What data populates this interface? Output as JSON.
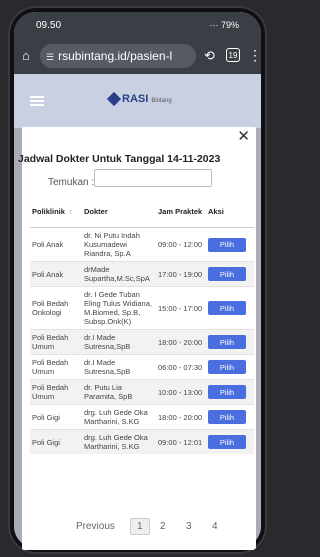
{
  "status": {
    "time": "09.50",
    "signal": "··· 79%"
  },
  "browser": {
    "url": "rsubintang.id/pasien-l",
    "tabs_count": "19"
  },
  "site": {
    "logo_text": "RASI",
    "logo_sub": "Bintang"
  },
  "modal": {
    "title": "Jadwal Dokter Untuk Tanggal 14-11-2023",
    "search_label": "Temukan :",
    "search_value": "",
    "columns": [
      "Poliklinik",
      "Dokter",
      "Jam Praktek",
      "Aksi"
    ],
    "action_label": "Pilih",
    "rows": [
      {
        "poli": "Poli Anak",
        "dokter": "dr. Ni Putu Indah Kusumadewi Riandra, Sp.A",
        "jam": "09:00 - 12:00"
      },
      {
        "poli": "Poli Anak",
        "dokter": "drMade Supartha,M.Sc,SpA",
        "jam": "17:00 - 19:00"
      },
      {
        "poli": "Poli Bedah Onkologi",
        "dokter": "dr. I Gede Tuban Eling Tulus Widiana, M.Biomed, Sp.B, Subsp.Onk(K)",
        "jam": "15:00 - 17:00"
      },
      {
        "poli": "Poli Bedah Umum",
        "dokter": "dr.I Made Sutresna,SpB",
        "jam": "18:00 - 20:00"
      },
      {
        "poli": "Poli Bedah Umum",
        "dokter": "dr.I Made Sutresna,SpB",
        "jam": "06:00 - 07:30"
      },
      {
        "poli": "Poli Bedah Umum",
        "dokter": "dr. Putu Lia Paramita, SpB",
        "jam": "10:00 - 13:00"
      },
      {
        "poli": "Poli Gigi",
        "dokter": "drg. Luh Gede Oka Martharini, S.KG",
        "jam": "18:00 - 20:00"
      },
      {
        "poli": "Poli Gigi",
        "dokter": "drg. Luh Gede Oka Martharini, S.KG",
        "jam": "09:00 - 12:01"
      }
    ],
    "pagination": {
      "previous": "Previous",
      "pages": [
        "1",
        "2",
        "3",
        "4"
      ],
      "current": "1"
    }
  }
}
